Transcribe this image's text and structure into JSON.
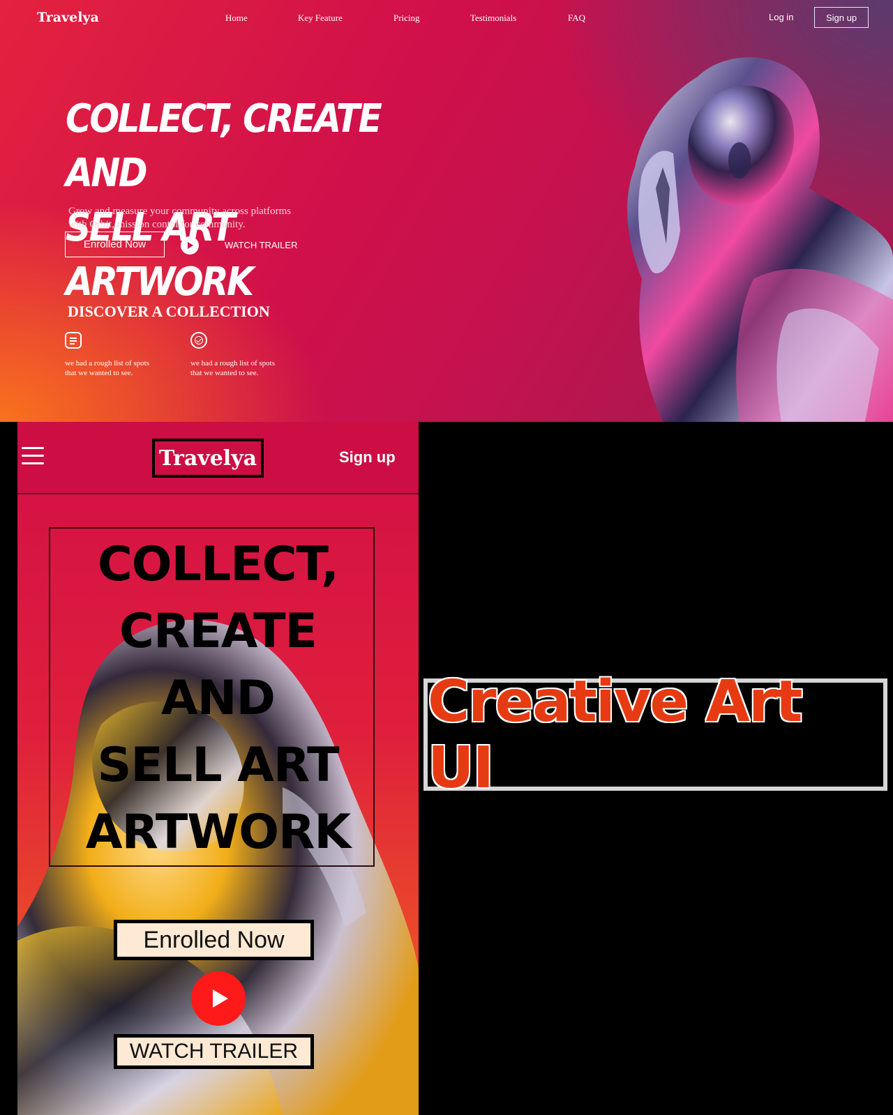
{
  "desktop": {
    "logo": "Travelya",
    "nav": [
      "Home",
      "Key Feature",
      "Pricing",
      "Testimonials",
      "FAQ"
    ],
    "login": "Log in",
    "signup": "Sign up",
    "headline_line1": "COLLECT, CREATE AND",
    "headline_line2": "SELL ART ARTWORK",
    "subtitle_line1": "Grow and measure your community across platforms",
    "subtitle_line2": "with Orbit, mission contol for community.",
    "enroll_label": "Enrolled Now",
    "watch_label": "WATCH TRAILER",
    "discover_title": "DISCOVER A COLLECTION",
    "features": [
      {
        "icon": "document-icon",
        "line1": "we had a rough list of spots",
        "line2": "that we wanted to see."
      },
      {
        "icon": "check-badge-icon",
        "line1": "we had a rough list of spots",
        "line2": "that we wanted to see."
      }
    ]
  },
  "mobile": {
    "logo": "Travelya",
    "signup": "Sign up",
    "title_lines": [
      "COLLECT,",
      "CREATE",
      "AND",
      "SELL ART",
      "ARTWORK"
    ],
    "enroll_label": "Enrolled Now",
    "watch_label": "WATCH TRAILER"
  },
  "caption": "Creative Art UI",
  "colors": {
    "desktop_bg_main": "#c4124f",
    "desktop_bg_orange": "#f9731c",
    "mobile_bg": "#d20f47",
    "play_button_red": "#ff1a1a",
    "button_cream": "#fde9d4",
    "caption_text": "#e63b12",
    "caption_border": "#d6d6d6"
  }
}
